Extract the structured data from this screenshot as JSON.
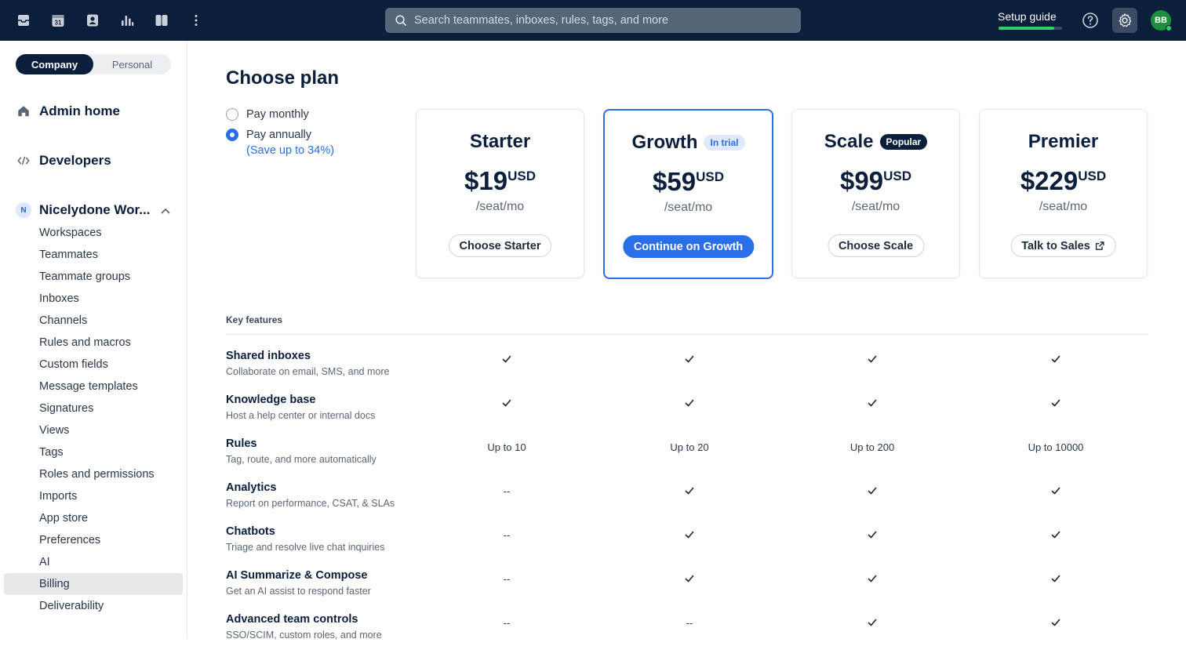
{
  "topbar": {
    "icons": [
      "inbox-icon",
      "calendar-icon",
      "contacts-icon",
      "analytics-icon",
      "knowledge-icon",
      "more-icon"
    ],
    "calendar_day": "31",
    "search_placeholder": "Search teammates, inboxes, rules, tags, and more",
    "setup_guide_label": "Setup guide",
    "setup_progress": 0.88,
    "avatar_initials": "BB",
    "colors": {
      "bar": "#0b1e3b",
      "accent": "#2a6ee8",
      "progress": "#2ed06a",
      "avatar": "#1e8e3e"
    }
  },
  "sidebar": {
    "toggle": {
      "company": "Company",
      "personal": "Personal",
      "selected": "Company"
    },
    "admin_home": "Admin home",
    "developers": "Developers",
    "workspace": {
      "initial": "N",
      "name": "Nicelydone Wor..."
    },
    "items": [
      {
        "label": "Workspaces"
      },
      {
        "label": "Teammates"
      },
      {
        "label": "Teammate groups"
      },
      {
        "label": "Inboxes"
      },
      {
        "label": "Channels"
      },
      {
        "label": "Rules and macros"
      },
      {
        "label": "Custom fields"
      },
      {
        "label": "Message templates"
      },
      {
        "label": "Signatures"
      },
      {
        "label": "Views"
      },
      {
        "label": "Tags"
      },
      {
        "label": "Roles and permissions"
      },
      {
        "label": "Imports"
      },
      {
        "label": "App store"
      },
      {
        "label": "Preferences"
      },
      {
        "label": "AI"
      },
      {
        "label": "Billing",
        "active": true
      },
      {
        "label": "Deliverability"
      }
    ]
  },
  "main": {
    "title": "Choose plan",
    "billing": {
      "monthly": "Pay monthly",
      "annually": "Pay annually",
      "save_note": "(Save up to 34%)",
      "selected": "annually"
    },
    "plans": [
      {
        "name": "Starter",
        "price": "$19",
        "currency": "USD",
        "per": "/seat/mo",
        "button": "Choose Starter"
      },
      {
        "name": "Growth",
        "badge": "In trial",
        "price": "$59",
        "currency": "USD",
        "per": "/seat/mo",
        "button": "Continue on Growth",
        "selected": true
      },
      {
        "name": "Scale",
        "badge": "Popular",
        "price": "$99",
        "currency": "USD",
        "per": "/seat/mo",
        "button": "Choose Scale"
      },
      {
        "name": "Premier",
        "price": "$229",
        "currency": "USD",
        "per": "/seat/mo",
        "button": "Talk to Sales"
      }
    ],
    "key_features_title": "Key features",
    "features": [
      {
        "name": "Shared inboxes",
        "desc": "Collaborate on email, SMS, and more",
        "values": [
          "check",
          "check",
          "check",
          "check"
        ]
      },
      {
        "name": "Knowledge base",
        "desc": "Host a help center or internal docs",
        "values": [
          "check",
          "check",
          "check",
          "check"
        ]
      },
      {
        "name": "Rules",
        "desc": "Tag, route, and more automatically",
        "values": [
          "Up to 10",
          "Up to 20",
          "Up to 200",
          "Up to 10000"
        ]
      },
      {
        "name": "Analytics",
        "desc": "Report on performance, CSAT, & SLAs",
        "values": [
          "--",
          "check",
          "check",
          "check"
        ]
      },
      {
        "name": "Chatbots",
        "desc": "Triage and resolve live chat inquiries",
        "values": [
          "--",
          "check",
          "check",
          "check"
        ]
      },
      {
        "name": "AI Summarize & Compose",
        "desc": "Get an AI assist to respond faster",
        "values": [
          "--",
          "check",
          "check",
          "check"
        ]
      },
      {
        "name": "Advanced team controls",
        "desc": "SSO/SCIM, custom roles, and more",
        "values": [
          "--",
          "--",
          "check",
          "check"
        ]
      }
    ]
  }
}
